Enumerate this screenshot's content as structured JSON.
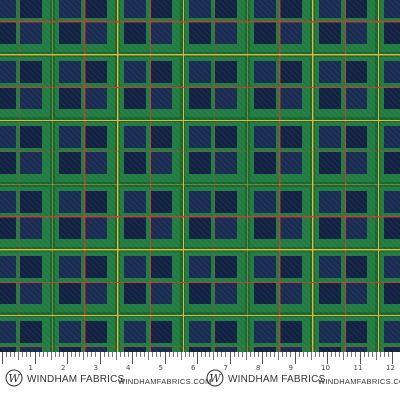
{
  "image": {
    "subject": "green and navy tartan plaid fabric swatch",
    "colors": {
      "green": "#1e7a3f",
      "green_dark": "#16652f",
      "navy": "#16294f",
      "navy_dark": "#0f1f40",
      "yellow_stripe": "#e3b62a",
      "red_stripe": "#c8382a",
      "selvage_background": "#ffffff",
      "ruler_ink": "#555555"
    }
  },
  "selvage": {
    "brand_name": "WINDHAM FABRICS",
    "brand_url": "WINDHAMFABRICS.COM",
    "logo_letter": "W",
    "inch_labels": [
      "1",
      "2",
      "3",
      "4",
      "5",
      "6",
      "7",
      "8",
      "9",
      "10",
      "11",
      "12"
    ]
  }
}
